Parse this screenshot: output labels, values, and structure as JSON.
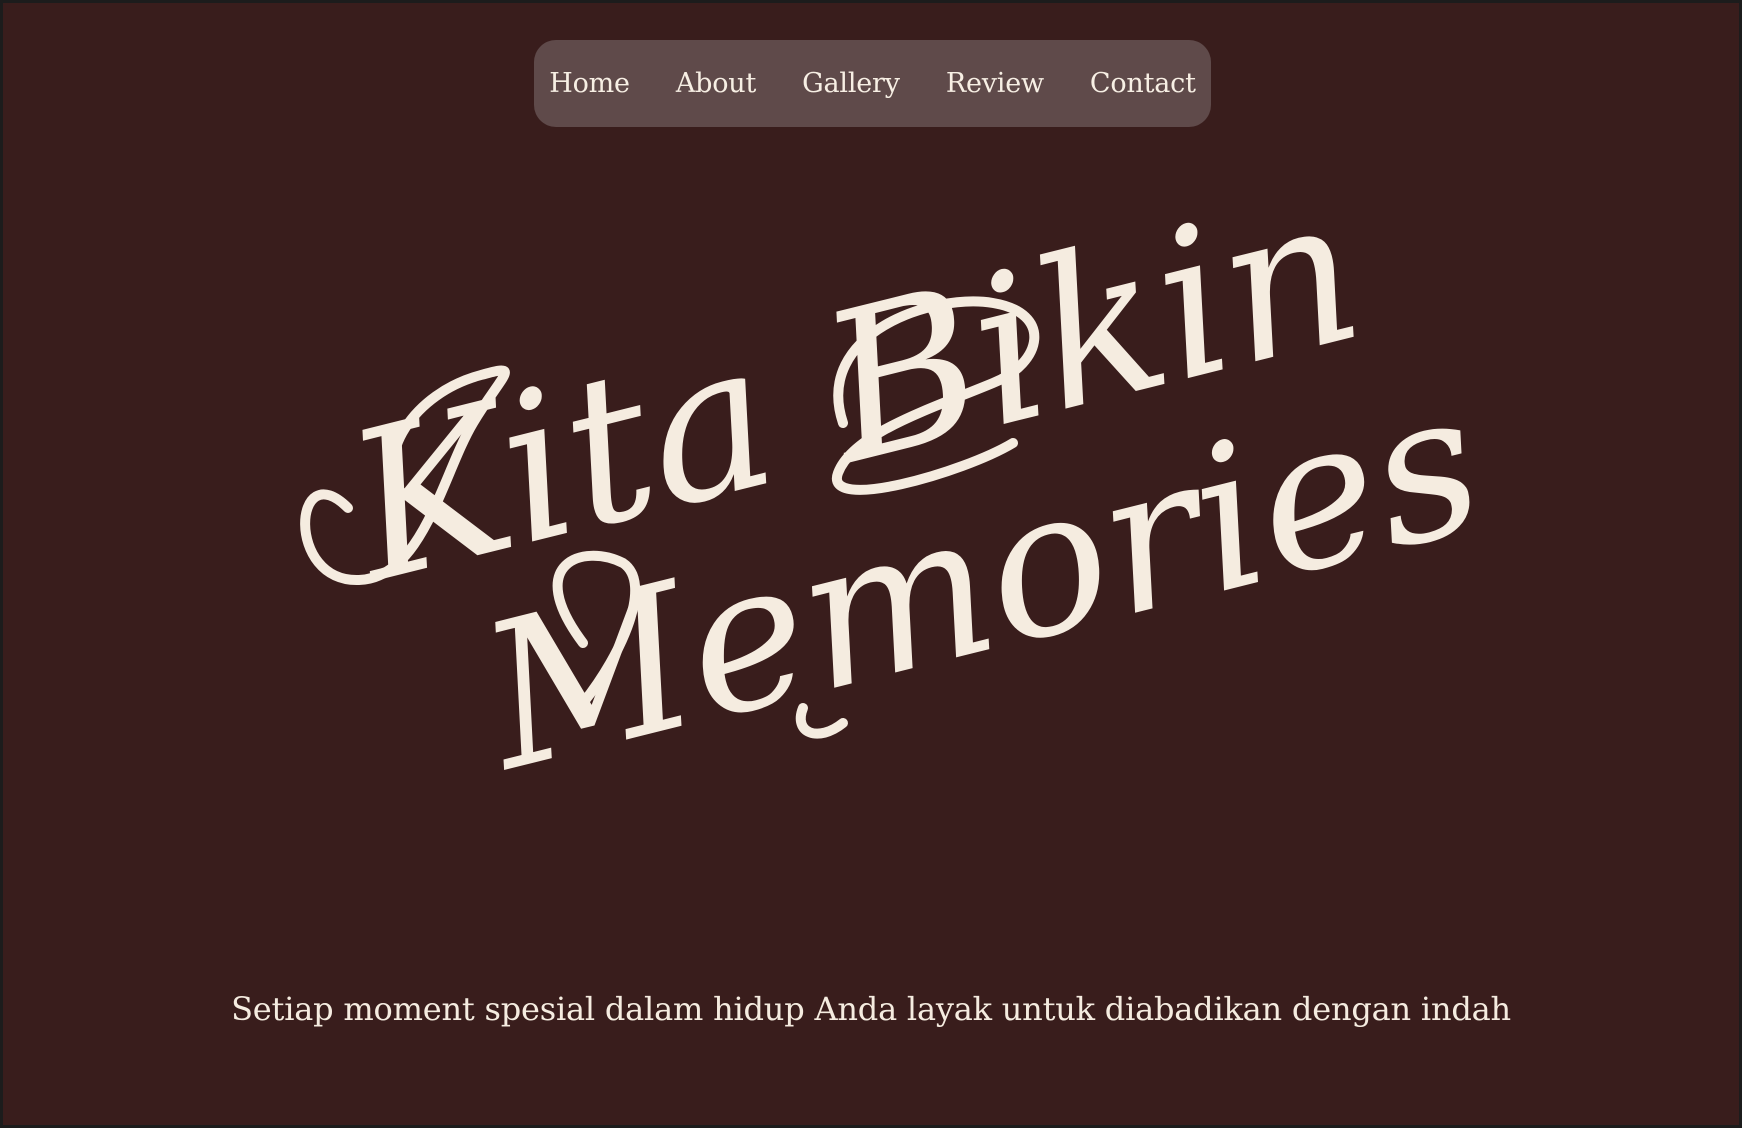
{
  "nav": {
    "items": [
      {
        "label": "Home"
      },
      {
        "label": "About"
      },
      {
        "label": "Gallery"
      },
      {
        "label": "Review"
      },
      {
        "label": "Contact"
      }
    ]
  },
  "hero": {
    "title_line1": "Kita Bikin",
    "title_line2": "Memories",
    "subtitle": "Setiap moment spesial dalam hidup Anda layak untuk diabadikan dengan indah"
  },
  "colors": {
    "background": "#391d1c",
    "frame": "#1c1c1c",
    "nav_background": "#5f4a4a",
    "text_cream": "#f5ece0"
  }
}
